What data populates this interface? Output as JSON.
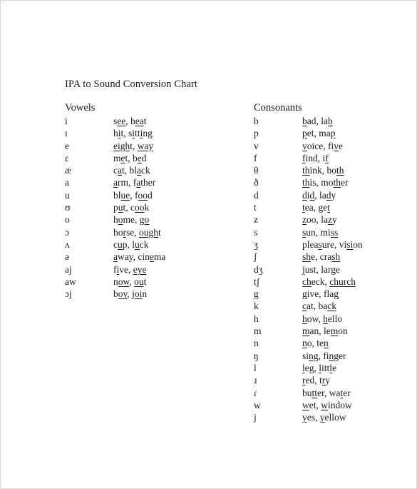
{
  "document": {
    "title": "IPA to Sound Conversion Chart"
  },
  "vowels": {
    "heading": "Vowels",
    "entries": [
      {
        "symbol": "i",
        "examples": "see, heat",
        "segments": [
          [
            "s",
            0
          ],
          [
            "ee",
            1
          ],
          [
            ", h",
            0
          ],
          [
            "ea",
            1
          ],
          [
            "t",
            0
          ]
        ]
      },
      {
        "symbol": "ɪ",
        "examples": "hit, sitting",
        "segments": [
          [
            "h",
            0
          ],
          [
            "i",
            1
          ],
          [
            "t, s",
            0
          ],
          [
            "i",
            1
          ],
          [
            "tt",
            0
          ],
          [
            "i",
            1
          ],
          [
            "ng",
            0
          ]
        ]
      },
      {
        "symbol": "e",
        "examples": "eight, way",
        "segments": [
          [
            "eigh",
            1
          ],
          [
            "t, ",
            0
          ],
          [
            "way",
            1
          ]
        ]
      },
      {
        "symbol": "ɛ",
        "examples": "met, bed",
        "segments": [
          [
            "m",
            0
          ],
          [
            "e",
            1
          ],
          [
            "t, b",
            0
          ],
          [
            "e",
            1
          ],
          [
            "d",
            0
          ]
        ]
      },
      {
        "symbol": "æ",
        "examples": "cat, black",
        "segments": [
          [
            "c",
            0
          ],
          [
            "a",
            1
          ],
          [
            "t, bl",
            0
          ],
          [
            "a",
            1
          ],
          [
            "ck",
            0
          ]
        ]
      },
      {
        "symbol": "a",
        "examples": "arm, father",
        "segments": [
          [
            "a",
            1
          ],
          [
            "rm, f",
            0
          ],
          [
            "a",
            1
          ],
          [
            "ther",
            0
          ]
        ]
      },
      {
        "symbol": "u",
        "examples": "blue, food",
        "segments": [
          [
            "bl",
            0
          ],
          [
            "ue",
            1
          ],
          [
            ", f",
            0
          ],
          [
            "oo",
            1
          ],
          [
            "d",
            0
          ]
        ]
      },
      {
        "symbol": "ʊ",
        "examples": "put, cook",
        "segments": [
          [
            "p",
            0
          ],
          [
            "u",
            1
          ],
          [
            "t, c",
            0
          ],
          [
            "oo",
            1
          ],
          [
            "k",
            0
          ]
        ]
      },
      {
        "symbol": "o",
        "examples": "home, go",
        "segments": [
          [
            "h",
            0
          ],
          [
            "o",
            1
          ],
          [
            "me, g",
            0
          ],
          [
            "o",
            1
          ]
        ]
      },
      {
        "symbol": "ɔ",
        "examples": "horse, ought",
        "segments": [
          [
            "ho",
            0
          ],
          [
            "r",
            1
          ],
          [
            "se, ",
            0
          ],
          [
            "ough",
            1
          ],
          [
            "t",
            0
          ]
        ]
      },
      {
        "symbol": "ʌ",
        "examples": "cup, luck",
        "segments": [
          [
            "c",
            0
          ],
          [
            "u",
            1
          ],
          [
            "p, l",
            0
          ],
          [
            "u",
            1
          ],
          [
            "ck",
            0
          ]
        ]
      },
      {
        "symbol": "ə",
        "examples": "away, cinema",
        "segments": [
          [
            "a",
            1
          ],
          [
            "way, cin",
            0
          ],
          [
            "e",
            1
          ],
          [
            "ma",
            0
          ]
        ]
      },
      {
        "symbol": "aj",
        "examples": "five, eye",
        "segments": [
          [
            "f",
            0
          ],
          [
            "i",
            1
          ],
          [
            "ve, ",
            0
          ],
          [
            "eye",
            1
          ]
        ]
      },
      {
        "symbol": "aw",
        "examples": "now, out",
        "segments": [
          [
            "n",
            0
          ],
          [
            "ow",
            1
          ],
          [
            ", ",
            0
          ],
          [
            "ou",
            1
          ],
          [
            "t",
            0
          ]
        ]
      },
      {
        "symbol": "ɔj",
        "examples": "boy, join",
        "segments": [
          [
            "b",
            0
          ],
          [
            "oy",
            1
          ],
          [
            ", j",
            0
          ],
          [
            "oi",
            1
          ],
          [
            "n",
            0
          ]
        ]
      }
    ]
  },
  "consonants": {
    "heading": "Consonants",
    "entries": [
      {
        "symbol": "b",
        "examples": "bad, lab",
        "segments": [
          [
            "b",
            1
          ],
          [
            "ad, la",
            0
          ],
          [
            "b",
            1
          ]
        ]
      },
      {
        "symbol": "p",
        "examples": "pet, map",
        "segments": [
          [
            "p",
            1
          ],
          [
            "et, ma",
            0
          ],
          [
            "p",
            1
          ]
        ]
      },
      {
        "symbol": "v",
        "examples": "voice, five",
        "segments": [
          [
            "v",
            1
          ],
          [
            "oice, fi",
            0
          ],
          [
            "v",
            1
          ],
          [
            "e",
            0
          ]
        ]
      },
      {
        "symbol": "f",
        "examples": "find, if",
        "segments": [
          [
            "f",
            1
          ],
          [
            "ind, i",
            0
          ],
          [
            "f",
            1
          ]
        ]
      },
      {
        "symbol": "θ",
        "examples": "think, both",
        "segments": [
          [
            "th",
            1
          ],
          [
            "ink, bo",
            0
          ],
          [
            "th",
            1
          ]
        ]
      },
      {
        "symbol": "ð",
        "examples": "this, mother",
        "segments": [
          [
            "th",
            1
          ],
          [
            "is, mo",
            0
          ],
          [
            "th",
            1
          ],
          [
            "er",
            0
          ]
        ]
      },
      {
        "symbol": "d",
        "examples": "did, lady",
        "segments": [
          [
            "d",
            1
          ],
          [
            "i",
            0
          ],
          [
            "d",
            1
          ],
          [
            ", la",
            0
          ],
          [
            "d",
            1
          ],
          [
            "y",
            0
          ]
        ]
      },
      {
        "symbol": "t",
        "examples": "tea, get",
        "segments": [
          [
            "t",
            1
          ],
          [
            "ea, ge",
            0
          ],
          [
            "t",
            1
          ]
        ]
      },
      {
        "symbol": "z",
        "examples": "zoo, lazy",
        "segments": [
          [
            "z",
            1
          ],
          [
            "oo, la",
            0
          ],
          [
            "z",
            1
          ],
          [
            "y",
            0
          ]
        ]
      },
      {
        "symbol": "s",
        "examples": "sun, miss",
        "segments": [
          [
            "s",
            1
          ],
          [
            "un, mi",
            0
          ],
          [
            "ss",
            1
          ]
        ]
      },
      {
        "symbol": "ʒ",
        "examples": "pleasure, vision",
        "segments": [
          [
            "plea",
            0
          ],
          [
            "s",
            1
          ],
          [
            "ure, vi",
            0
          ],
          [
            "si",
            1
          ],
          [
            "on",
            0
          ]
        ]
      },
      {
        "symbol": "ʃ",
        "examples": "she, crash",
        "segments": [
          [
            "sh",
            1
          ],
          [
            "e, cra",
            0
          ],
          [
            "sh",
            1
          ]
        ]
      },
      {
        "symbol": "dʒ",
        "examples": "just, large",
        "segments": [
          [
            "j",
            1
          ],
          [
            "ust, lar",
            0
          ],
          [
            "g",
            1
          ],
          [
            "e",
            0
          ]
        ]
      },
      {
        "symbol": "tʃ",
        "examples": "check, church",
        "segments": [
          [
            "ch",
            1
          ],
          [
            "eck, ",
            0
          ],
          [
            "church",
            1
          ]
        ]
      },
      {
        "symbol": "g",
        "examples": "give, flag",
        "segments": [
          [
            "g",
            1
          ],
          [
            "ive, fla",
            0
          ],
          [
            "g",
            1
          ]
        ]
      },
      {
        "symbol": "k",
        "examples": "cat, back",
        "segments": [
          [
            "c",
            1
          ],
          [
            "at, ba",
            0
          ],
          [
            "ck",
            1
          ]
        ]
      },
      {
        "symbol": "h",
        "examples": "how, hello",
        "segments": [
          [
            "h",
            1
          ],
          [
            "ow, ",
            0
          ],
          [
            "h",
            1
          ],
          [
            "ello",
            0
          ]
        ]
      },
      {
        "symbol": "m",
        "examples": "man, lemon",
        "segments": [
          [
            "m",
            1
          ],
          [
            "an, le",
            0
          ],
          [
            "m",
            1
          ],
          [
            "on",
            0
          ]
        ]
      },
      {
        "symbol": "n",
        "examples": "no, ten",
        "segments": [
          [
            "n",
            1
          ],
          [
            "o, te",
            0
          ],
          [
            "n",
            1
          ]
        ]
      },
      {
        "symbol": "ŋ",
        "examples": "sing, finger",
        "segments": [
          [
            "si",
            0
          ],
          [
            "ng",
            1
          ],
          [
            ", fi",
            0
          ],
          [
            "ng",
            1
          ],
          [
            "er",
            0
          ]
        ]
      },
      {
        "symbol": "l",
        "examples": "leg, little",
        "segments": [
          [
            "l",
            1
          ],
          [
            "eg, ",
            0
          ],
          [
            "l",
            1
          ],
          [
            "itt",
            0
          ],
          [
            "l",
            1
          ],
          [
            "e",
            0
          ]
        ]
      },
      {
        "symbol": "ɹ",
        "examples": "red, try",
        "segments": [
          [
            "r",
            1
          ],
          [
            "ed, t",
            0
          ],
          [
            "r",
            1
          ],
          [
            "y",
            0
          ]
        ]
      },
      {
        "symbol": "ɾ",
        "examples": "butter, water",
        "segments": [
          [
            "bu",
            0
          ],
          [
            "tt",
            1
          ],
          [
            "er, wa",
            0
          ],
          [
            "t",
            1
          ],
          [
            "er",
            0
          ]
        ]
      },
      {
        "symbol": "w",
        "examples": "wet, window",
        "segments": [
          [
            "w",
            1
          ],
          [
            "et, ",
            0
          ],
          [
            "w",
            1
          ],
          [
            "indow",
            0
          ]
        ]
      },
      {
        "symbol": "j",
        "examples": "yes, yellow",
        "segments": [
          [
            "y",
            1
          ],
          [
            "es, ",
            0
          ],
          [
            "y",
            1
          ],
          [
            "ellow",
            0
          ]
        ]
      }
    ]
  }
}
